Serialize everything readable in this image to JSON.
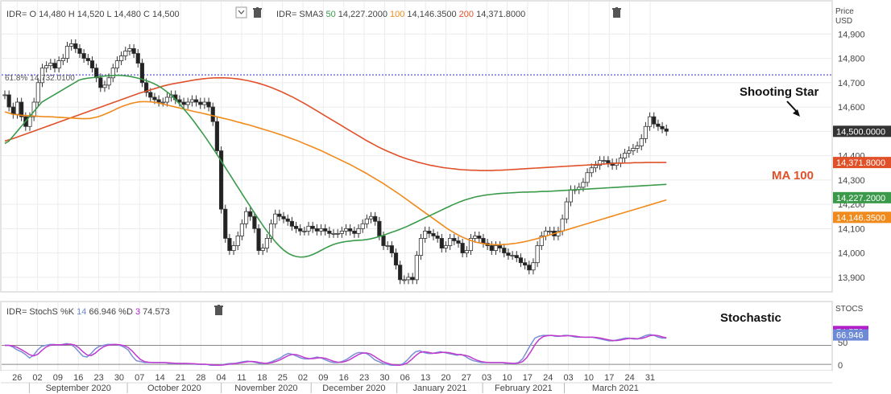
{
  "price_header": {
    "symbol": "IDR=",
    "open_label": "O",
    "open": "14,480",
    "high_label": "H",
    "high": "14,520",
    "low_label": "L",
    "low": "14,480",
    "close_label": "C",
    "close": "14,500",
    "sma_symbol": "IDR= SMA3",
    "sma_periods": [
      "50",
      "100",
      "200"
    ],
    "sma_values": [
      "14,227.2000",
      "14,146.3500",
      "14,371.8000"
    ]
  },
  "stoch_header": {
    "label": "IDR= StochS",
    "k_label": "%K",
    "k_period": "14",
    "k_value": "66.946",
    "d_label": "%D",
    "d_period": "3",
    "d_value": "74.573"
  },
  "price_axis_title": [
    "Price",
    "USD"
  ],
  "stoch_axis_title": "STOCS",
  "annotations": {
    "shooting_star": "Shooting Star",
    "ma100": "MA 100",
    "stochastic": "Stochastic",
    "fib": "61.8%",
    "fib_value": "14,732.0100"
  },
  "price_badges": [
    {
      "text": "14,500.0000",
      "value": 14500,
      "color": "#333333"
    },
    {
      "text": "14,371.8000",
      "value": 14371.8,
      "color": "#e0512a"
    },
    {
      "text": "14,227.2000",
      "value": 14227.2,
      "color": "#3a9a4a"
    },
    {
      "text": "14,146.3500",
      "value": 14146.35,
      "color": "#f08a1c"
    }
  ],
  "stoch_badges": [
    {
      "text": "74.573",
      "value": 74.573,
      "color": "#b01fc8"
    },
    {
      "text": "66.946",
      "value": 66.946,
      "color": "#6e8ad4"
    }
  ],
  "colors": {
    "sma50": "#3a9a4a",
    "sma100": "#f08a1c",
    "sma200": "#e0512a",
    "stoch_k": "#7b8fd6",
    "stoch_d": "#c03ad0",
    "fib": "#5a5ad6"
  },
  "icons": [
    "trash-icon",
    "chevron-down-icon"
  ],
  "chart_data": {
    "type": "line",
    "price_axis": {
      "ylim": [
        13840,
        15020
      ],
      "ticks": [
        13900,
        14000,
        14100,
        14200,
        14300,
        14400,
        14500,
        14600,
        14700,
        14800,
        14900
      ],
      "tick_labels": [
        "13,900",
        "14,000",
        "14,100",
        "14,200",
        "14,300",
        "14,400",
        "14,500",
        "14,600",
        "14,700",
        "14,800",
        "14,900"
      ]
    },
    "stoch_axis": {
      "ylim": [
        -5,
        100
      ],
      "ticks": [
        0,
        50
      ],
      "tick_labels": [
        "0",
        "50"
      ]
    },
    "fib_level": 14732.01,
    "x_range": [
      0,
      202
    ],
    "date_ticks": [
      {
        "label": "26",
        "i": 3
      },
      {
        "label": "02",
        "i": 8
      },
      {
        "label": "09",
        "i": 13
      },
      {
        "label": "16",
        "i": 18
      },
      {
        "label": "23",
        "i": 23
      },
      {
        "label": "30",
        "i": 28
      },
      {
        "label": "07",
        "i": 33
      },
      {
        "label": "14",
        "i": 38
      },
      {
        "label": "21",
        "i": 43
      },
      {
        "label": "28",
        "i": 48
      },
      {
        "label": "04",
        "i": 53
      },
      {
        "label": "11",
        "i": 58
      },
      {
        "label": "18",
        "i": 63
      },
      {
        "label": "25",
        "i": 68
      },
      {
        "label": "02",
        "i": 73
      },
      {
        "label": "09",
        "i": 78
      },
      {
        "label": "16",
        "i": 83
      },
      {
        "label": "23",
        "i": 88
      },
      {
        "label": "30",
        "i": 93
      },
      {
        "label": "06",
        "i": 98
      },
      {
        "label": "13",
        "i": 103
      },
      {
        "label": "20",
        "i": 108
      },
      {
        "label": "27",
        "i": 113
      },
      {
        "label": "03",
        "i": 118
      },
      {
        "label": "10",
        "i": 123
      },
      {
        "label": "17",
        "i": 128
      },
      {
        "label": "24",
        "i": 133
      },
      {
        "label": "03",
        "i": 138
      },
      {
        "label": "10",
        "i": 143
      },
      {
        "label": "17",
        "i": 148
      },
      {
        "label": "24",
        "i": 153
      },
      {
        "label": "31",
        "i": 158
      }
    ],
    "months": [
      {
        "label": "September 2020",
        "from": 6,
        "to": 30
      },
      {
        "label": "October 2020",
        "from": 30,
        "to": 53
      },
      {
        "label": "November 2020",
        "from": 53,
        "to": 75
      },
      {
        "label": "December 2020",
        "from": 75,
        "to": 96
      },
      {
        "label": "January 2021",
        "from": 96,
        "to": 117
      },
      {
        "label": "February 2021",
        "from": 117,
        "to": 137
      },
      {
        "label": "March 2021",
        "from": 137,
        "to": 162
      }
    ],
    "closes": [
      14650,
      14600,
      14570,
      14620,
      14560,
      14520,
      14560,
      14620,
      14700,
      14760,
      14770,
      14780,
      14760,
      14790,
      14800,
      14850,
      14860,
      14840,
      14820,
      14800,
      14790,
      14760,
      14720,
      14680,
      14690,
      14720,
      14760,
      14790,
      14810,
      14830,
      14840,
      14820,
      14780,
      14700,
      14660,
      14640,
      14630,
      14620,
      14620,
      14640,
      14650,
      14630,
      14620,
      14610,
      14620,
      14630,
      14620,
      14610,
      14620,
      14600,
      14540,
      14420,
      14180,
      14060,
      14010,
      14030,
      14070,
      14120,
      14170,
      14150,
      14100,
      14010,
      14020,
      14060,
      14120,
      14160,
      14150,
      14140,
      14130,
      14110,
      14100,
      14090,
      14090,
      14110,
      14100,
      14090,
      14100,
      14090,
      14080,
      14080,
      14080,
      14090,
      14100,
      14090,
      14080,
      14100,
      14120,
      14140,
      14150,
      14130,
      14070,
      14030,
      14030,
      14000,
      13950,
      13890,
      13890,
      13900,
      13890,
      13990,
      14060,
      14090,
      14080,
      14070,
      14060,
      14020,
      14030,
      14060,
      14050,
      14040,
      14000,
      14010,
      14060,
      14070,
      14060,
      14040,
      14030,
      14010,
      14030,
      14020,
      14000,
      13990,
      13990,
      13980,
      13960,
      13950,
      13930,
      13960,
      14030,
      14070,
      14090,
      14090,
      14070,
      14090,
      14140,
      14210,
      14260,
      14260,
      14270,
      14290,
      14330,
      14350,
      14360,
      14380,
      14380,
      14370,
      14360,
      14370,
      14390,
      14410,
      14420,
      14430,
      14440,
      14470,
      14520,
      14560,
      14530,
      14520,
      14510,
      14500
    ],
    "sma50": [
      14450,
      14460,
      14480,
      14500,
      14520,
      14540,
      14560,
      14580,
      14600,
      14620,
      14630,
      14640,
      14650,
      14660,
      14670,
      14680,
      14690,
      14700,
      14710,
      14715,
      14718,
      14720,
      14722,
      14725,
      14727,
      14728,
      14729,
      14730,
      14730,
      14729,
      14727,
      14724,
      14720,
      14716,
      14711,
      14705,
      14698,
      14690,
      14680,
      14668,
      14655,
      14640,
      14622,
      14603,
      14583,
      14563,
      14541,
      14518,
      14495,
      14471,
      14446,
      14421,
      14395,
      14369,
      14342,
      14316,
      14289,
      14263,
      14236,
      14210,
      14184,
      14158,
      14133,
      14108,
      14085,
      14063,
      14043,
      14025,
      14010,
      13998,
      13990,
      13985,
      13983,
      13984,
      13988,
      13994,
      14002,
      14011,
      14020,
      14028,
      14035,
      14040,
      14044,
      14047,
      14049,
      14051,
      14052,
      14053,
      14055,
      14058,
      14062,
      14067,
      14072,
      14078,
      14084,
      14090,
      14096,
      14103,
      14110,
      14118,
      14126,
      14134,
      14142,
      14150,
      14158,
      14166,
      14174,
      14182,
      14190,
      14198,
      14205,
      14212,
      14218,
      14223,
      14228,
      14232,
      14235,
      14238,
      14240,
      14242,
      14244,
      14245,
      14246,
      14247,
      14248,
      14249,
      14250,
      14250,
      14251,
      14251,
      14252,
      14253,
      14253,
      14254,
      14255,
      14256,
      14257,
      14258,
      14259,
      14260,
      14261,
      14262,
      14263,
      14264,
      14265,
      14266,
      14267,
      14268,
      14269,
      14270,
      14271,
      14272,
      14273,
      14274,
      14275,
      14276,
      14277,
      14278,
      14279,
      14280,
      14281,
      14282
    ],
    "sma100": [
      14580,
      14575,
      14570,
      14568,
      14566,
      14565,
      14564,
      14563,
      14562,
      14561,
      14560,
      14560,
      14559,
      14558,
      14557,
      14556,
      14555,
      14554,
      14553,
      14552,
      14552,
      14553,
      14556,
      14560,
      14566,
      14573,
      14580,
      14588,
      14596,
      14603,
      14609,
      14614,
      14618,
      14621,
      14622,
      14622,
      14621,
      14619,
      14616,
      14612,
      14608,
      14604,
      14600,
      14596,
      14592,
      14588,
      14584,
      14580,
      14577,
      14573,
      14569,
      14565,
      14561,
      14557,
      14553,
      14549,
      14545,
      14540,
      14536,
      14531,
      14527,
      14522,
      14517,
      14512,
      14507,
      14502,
      14497,
      14491,
      14486,
      14480,
      14474,
      14468,
      14462,
      14455,
      14448,
      14441,
      14434,
      14427,
      14420,
      14412,
      14404,
      14396,
      14388,
      14380,
      14372,
      14364,
      14355,
      14346,
      14337,
      14328,
      14318,
      14308,
      14298,
      14288,
      14277,
      14266,
      14255,
      14244,
      14232,
      14220,
      14208,
      14196,
      14184,
      14172,
      14160,
      14148,
      14136,
      14124,
      14112,
      14100,
      14090,
      14080,
      14071,
      14063,
      14056,
      14050,
      14045,
      14041,
      14038,
      14036,
      14035,
      14034,
      14034,
      14035,
      14036,
      14038,
      14040,
      14043,
      14046,
      14050,
      14054,
      14058,
      14063,
      14068,
      14073,
      14078,
      14083,
      14088,
      14093,
      14098,
      14103,
      14108,
      14113,
      14118,
      14123,
      14128,
      14133,
      14138,
      14143,
      14148,
      14153,
      14158,
      14163,
      14168,
      14173,
      14178,
      14183,
      14188,
      14193,
      14198,
      14203,
      14208,
      14213,
      14218
    ],
    "sma200": [
      14460,
      14465,
      14470,
      14476,
      14482,
      14488,
      14494,
      14500,
      14506,
      14512,
      14518,
      14524,
      14530,
      14536,
      14542,
      14548,
      14554,
      14560,
      14566,
      14572,
      14578,
      14584,
      14590,
      14596,
      14602,
      14608,
      14614,
      14620,
      14626,
      14632,
      14638,
      14644,
      14650,
      14656,
      14661,
      14666,
      14671,
      14676,
      14681,
      14686,
      14690,
      14694,
      14697,
      14700,
      14703,
      14706,
      14709,
      14712,
      14714,
      14716,
      14718,
      14719,
      14720,
      14720,
      14720,
      14719,
      14718,
      14716,
      14714,
      14711,
      14708,
      14704,
      14700,
      14695,
      14690,
      14684,
      14678,
      14671,
      14664,
      14656,
      14648,
      14640,
      14631,
      14622,
      14613,
      14603,
      14593,
      14583,
      14573,
      14563,
      14553,
      14543,
      14533,
      14523,
      14513,
      14503,
      14493,
      14483,
      14473,
      14463,
      14454,
      14445,
      14436,
      14428,
      14420,
      14413,
      14406,
      14399,
      14393,
      14387,
      14382,
      14377,
      14372,
      14368,
      14364,
      14360,
      14357,
      14354,
      14351,
      14349,
      14347,
      14345,
      14343,
      14342,
      14341,
      14340,
      14340,
      14339,
      14339,
      14339,
      14339,
      14340,
      14340,
      14341,
      14342,
      14343,
      14344,
      14345,
      14346,
      14347,
      14348,
      14349,
      14350,
      14351,
      14352,
      14353,
      14354,
      14355,
      14356,
      14357,
      14358,
      14359,
      14360,
      14361,
      14362,
      14363,
      14364,
      14365,
      14366,
      14367,
      14368,
      14369,
      14369,
      14370,
      14370,
      14371,
      14371,
      14371,
      14372,
      14372,
      14372,
      14372,
      14372,
      14372
    ],
    "stoch_k": [
      44,
      44,
      40,
      34,
      30,
      24,
      16,
      22,
      34,
      42,
      44,
      46,
      46,
      44,
      46,
      48,
      46,
      40,
      30,
      20,
      18,
      26,
      36,
      42,
      44,
      46,
      46,
      46,
      44,
      40,
      34,
      20,
      10,
      8,
      6,
      6,
      6,
      6,
      6,
      6,
      4,
      4,
      4,
      4,
      4,
      3,
      3,
      2,
      2,
      2,
      0,
      0,
      0,
      1,
      3,
      4,
      4,
      6,
      8,
      9,
      8,
      6,
      4,
      4,
      5,
      8,
      12,
      16,
      22,
      26,
      24,
      20,
      16,
      14,
      14,
      16,
      18,
      16,
      12,
      8,
      6,
      6,
      8,
      12,
      18,
      24,
      28,
      28,
      26,
      20,
      12,
      8,
      4,
      2,
      0,
      0,
      0,
      4,
      12,
      22,
      30,
      32,
      28,
      26,
      26,
      28,
      30,
      28,
      26,
      24,
      22,
      24,
      20,
      14,
      10,
      8,
      6,
      6,
      6,
      6,
      6,
      6,
      4,
      4,
      4,
      6,
      14,
      30,
      46,
      60,
      64,
      66,
      66,
      66,
      64,
      64,
      66,
      66,
      64,
      62,
      62,
      62,
      62,
      62,
      60,
      58,
      56,
      54,
      54,
      56,
      58,
      60,
      60,
      58,
      58,
      62,
      66,
      68,
      66,
      62,
      60,
      60
    ]
  }
}
